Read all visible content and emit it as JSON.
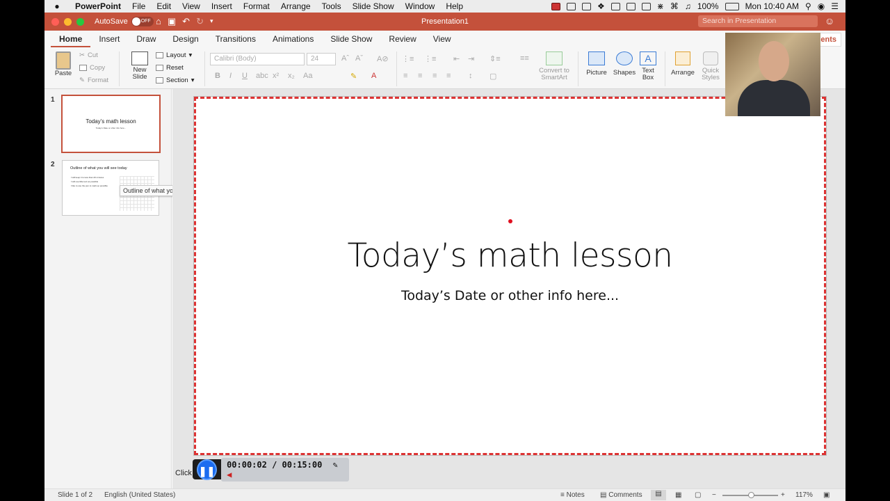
{
  "menubar": {
    "app": "PowerPoint",
    "items": [
      "File",
      "Edit",
      "View",
      "Insert",
      "Format",
      "Arrange",
      "Tools",
      "Slide Show",
      "Window",
      "Help"
    ],
    "battery": "100%",
    "clock": "Mon 10:40 AM"
  },
  "titlebar": {
    "autosave_label": "AutoSave",
    "autosave_state": "OFF",
    "document": "Presentation1",
    "search_placeholder": "Search in Presentation"
  },
  "tabs": [
    "Home",
    "Insert",
    "Draw",
    "Design",
    "Transitions",
    "Animations",
    "Slide Show",
    "Review",
    "View"
  ],
  "comments_button": "Comments",
  "ribbon": {
    "paste": "Paste",
    "cut": "Cut",
    "copy": "Copy",
    "format": "Format",
    "new_slide": "New Slide",
    "layout": "Layout",
    "reset": "Reset",
    "section": "Section",
    "font_name": "Calibri (Body)",
    "font_size": "24",
    "convert_smartart": "Convert to SmartArt",
    "picture": "Picture",
    "shapes": "Shapes",
    "text_box": "Text Box",
    "arrange": "Arrange",
    "quick_styles": "Quick Styles"
  },
  "thumbnails": [
    {
      "num": "1",
      "title": "Today’s math lesson",
      "sub": "Today’s Date or other info here..."
    },
    {
      "num": "2",
      "title": "Outline of what you will see today",
      "bullets": [
        "I will keep it to less than 20 minutes",
        "I will use little text as possible",
        "I like to use the pen to mark up possible"
      ]
    }
  ],
  "tooltip": "Outline of what you will see today",
  "slide": {
    "title": "Today’s math lesson",
    "subtitle": "Today’s Date or other info here..."
  },
  "recorder": {
    "time": "00:00:02 / 00:15:00",
    "click_label": "Click"
  },
  "status": {
    "slide_info": "Slide 1 of 2",
    "language": "English (United States)",
    "notes": "Notes",
    "comments": "Comments",
    "zoom": "117%",
    "zoom_level_percent": 117
  },
  "colors": {
    "accent": "#c4513b",
    "slide_border": "#dd3333",
    "recorder_button": "#1b6cf0"
  }
}
